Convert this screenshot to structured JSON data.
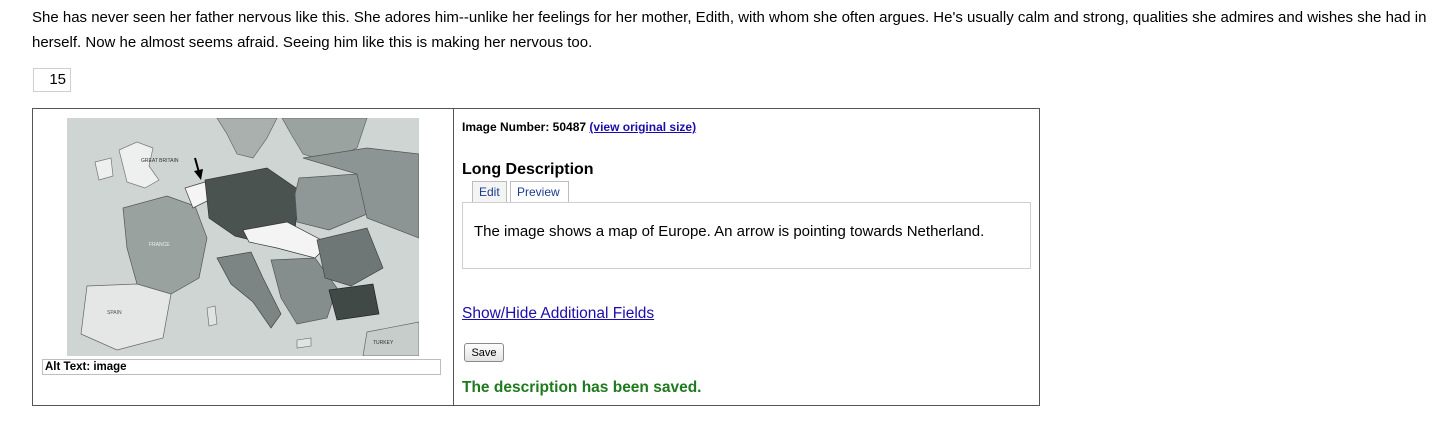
{
  "story": {
    "text": "She has never seen her father nervous like this. She adores him--unlike her feelings for her mother, Edith, with whom she often argues. He's usually calm and strong, qualities she admires and wishes she had in herself. Now he almost seems afraid. Seeing him like this is making her nervous too."
  },
  "page_number": "15",
  "image_panel": {
    "alt_text": "Alt Text: image",
    "map_labels": {
      "britain": "GREAT BRITAIN",
      "france": "FRANCE",
      "spain": "SPAIN",
      "turkey": "TURKEY"
    }
  },
  "details": {
    "image_number_label": "Image Number: 50487",
    "view_link": "(view original size)",
    "long_description_title": "Long Description",
    "tabs": [
      {
        "label": "Edit"
      },
      {
        "label": "Preview"
      }
    ],
    "description_text": "The image shows a map of Europe. An arrow is pointing towards Netherland.",
    "toggle_link": "Show/Hide Additional Fields",
    "save_label": "Save",
    "status_message": "The description has been saved."
  },
  "colors": {
    "link": "#1a0dab",
    "success": "#1e7a1e"
  }
}
